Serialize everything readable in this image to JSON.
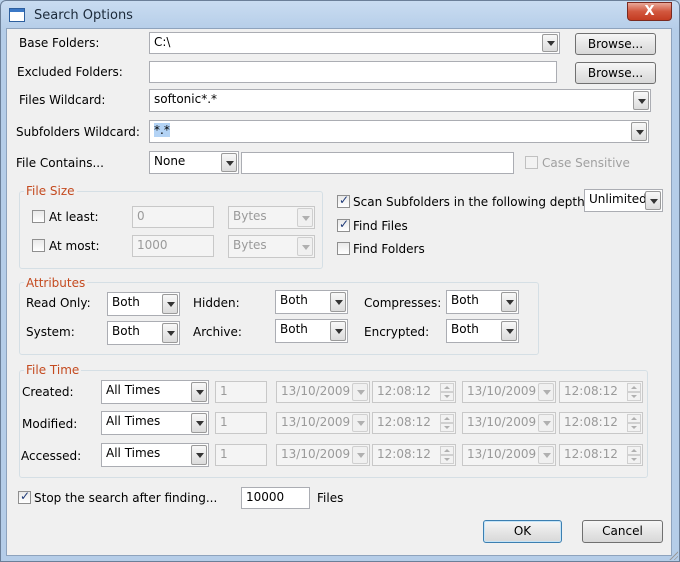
{
  "window": {
    "title": "Search Options",
    "close_label": "X"
  },
  "base_folders": {
    "label": "Base Folders:",
    "value": "C:\\",
    "browse_label": "Browse..."
  },
  "excluded_folders": {
    "label": "Excluded Folders:",
    "value": "",
    "browse_label": "Browse..."
  },
  "files_wildcard": {
    "label": "Files Wildcard:",
    "value": "softonic*.*"
  },
  "subfolders_wildcard": {
    "label": "Subfolders Wildcard:",
    "value": "*.*"
  },
  "file_contains": {
    "label": "File Contains...",
    "mode": "None",
    "value": "",
    "case_label": "Case Sensitive",
    "case_checked": false
  },
  "file_size": {
    "title": "File Size",
    "at_least": {
      "label": "At least:",
      "checked": false,
      "value": "0",
      "unit": "Bytes"
    },
    "at_most": {
      "label": "At most:",
      "checked": false,
      "value": "1000",
      "unit": "Bytes"
    }
  },
  "options": {
    "scan_label": "Scan Subfolders in the following depth:",
    "scan_checked": true,
    "depth": "Unlimited",
    "find_files_label": "Find Files",
    "find_files_checked": true,
    "find_folders_label": "Find Folders",
    "find_folders_checked": false
  },
  "attributes": {
    "title": "Attributes",
    "read_only": {
      "label": "Read Only:",
      "value": "Both"
    },
    "hidden": {
      "label": "Hidden:",
      "value": "Both"
    },
    "compresses": {
      "label": "Compresses:",
      "value": "Both"
    },
    "system": {
      "label": "System:",
      "value": "Both"
    },
    "archive": {
      "label": "Archive:",
      "value": "Both"
    },
    "encrypted": {
      "label": "Encrypted:",
      "value": "Both"
    }
  },
  "file_time": {
    "title": "File Time",
    "rows": [
      {
        "label": "Created:",
        "mode": "All Times",
        "count": "1",
        "date1": "13/10/2009",
        "time1": "12:08:12",
        "date2": "13/10/2009",
        "time2": "12:08:12"
      },
      {
        "label": "Modified:",
        "mode": "All Times",
        "count": "1",
        "date1": "13/10/2009",
        "time1": "12:08:12",
        "date2": "13/10/2009",
        "time2": "12:08:12"
      },
      {
        "label": "Accessed:",
        "mode": "All Times",
        "count": "1",
        "date1": "13/10/2009",
        "time1": "12:08:12",
        "date2": "13/10/2009",
        "time2": "12:08:12"
      }
    ]
  },
  "stop": {
    "label": "Stop the search after finding...",
    "checked": true,
    "value": "10000",
    "suffix": "Files"
  },
  "buttons": {
    "ok": "OK",
    "cancel": "Cancel"
  }
}
